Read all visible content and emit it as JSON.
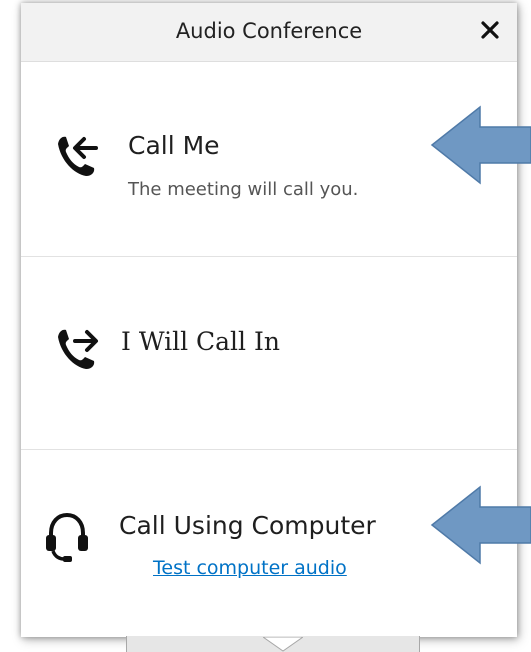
{
  "dialog": {
    "title": "Audio Conference",
    "close_icon": "close-icon"
  },
  "options": [
    {
      "icon": "phone-incoming-icon",
      "title": "Call Me",
      "subtitle": "The meeting will call you."
    },
    {
      "icon": "phone-outgoing-icon",
      "title": "I Will Call In"
    },
    {
      "icon": "headset-icon",
      "title": "Call Using Computer",
      "link": "Test computer audio"
    }
  ],
  "annotations": {
    "arrow_color": "#6f98c3",
    "arrow_icon": "left-pointing-callout-arrow"
  },
  "colors": {
    "link": "#0072c6",
    "title_bar": "#f2f2f2"
  }
}
